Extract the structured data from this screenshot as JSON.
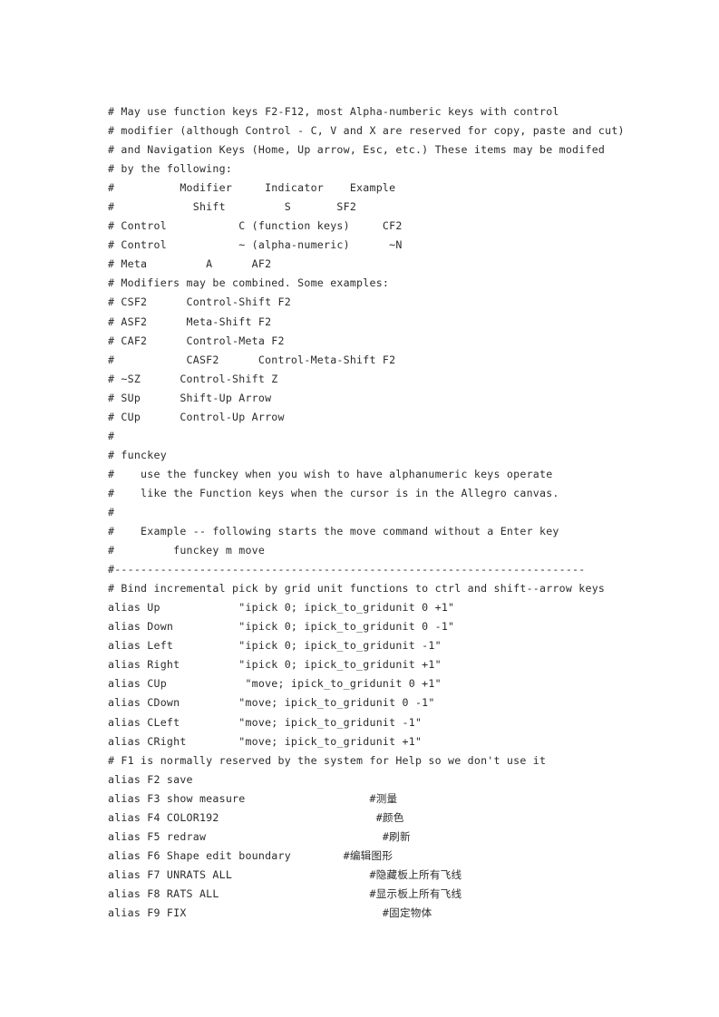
{
  "document": {
    "kind": "plain-text-source-listing",
    "background_color": "#ffffff",
    "text_color": "#2b2b2b",
    "lines": [
      "# May use function keys F2-F12, most Alpha-numberic keys with control",
      "# modifier (although Control - C, V and X are reserved for copy, paste and cut)",
      "# and Navigation Keys (Home, Up arrow, Esc, etc.) These items may be modifed",
      "# by the following:",
      "#          Modifier     Indicator    Example",
      "#            Shift         S       SF2",
      "# Control           C (function keys)     CF2",
      "# Control           ~ (alpha-numeric)      ~N",
      "# Meta         A      AF2",
      "# Modifiers may be combined. Some examples:",
      "# CSF2      Control-Shift F2",
      "# ASF2      Meta-Shift F2",
      "# CAF2      Control-Meta F2",
      "#           CASF2      Control-Meta-Shift F2",
      "# ~SZ      Control-Shift Z",
      "# SUp      Shift-Up Arrow",
      "# CUp      Control-Up Arrow",
      "#",
      "# funckey",
      "#    use the funckey when you wish to have alphanumeric keys operate",
      "#    like the Function keys when the cursor is in the Allegro canvas.",
      "#",
      "#    Example -- following starts the move command without a Enter key",
      "#         funckey m move",
      "#------------------------------------------------------------------------",
      "# Bind incremental pick by grid unit functions to ctrl and shift--arrow keys",
      "alias Up            \"ipick 0; ipick_to_gridunit 0 +1\"",
      "alias Down          \"ipick 0; ipick_to_gridunit 0 -1\"",
      "alias Left          \"ipick 0; ipick_to_gridunit -1\"",
      "alias Right         \"ipick 0; ipick_to_gridunit +1\"",
      "alias CUp            \"move; ipick_to_gridunit 0 +1\"",
      "alias CDown         \"move; ipick_to_gridunit 0 -1\"",
      "alias CLeft         \"move; ipick_to_gridunit -1\"",
      "alias CRight        \"move; ipick_to_gridunit +1\"",
      "# F1 is normally reserved by the system for Help so we don't use it",
      "alias F2 save",
      "alias F3 show measure                   #测量",
      "alias F4 COLOR192                        #颜色",
      "alias F5 redraw                           #刷新",
      "alias F6 Shape edit boundary        #编辑图形",
      "alias F7 UNRATS ALL                     #隐藏板上所有飞线",
      "alias F8 RATS ALL                       #显示板上所有飞线",
      "alias F9 FIX                              #固定物体"
    ]
  }
}
